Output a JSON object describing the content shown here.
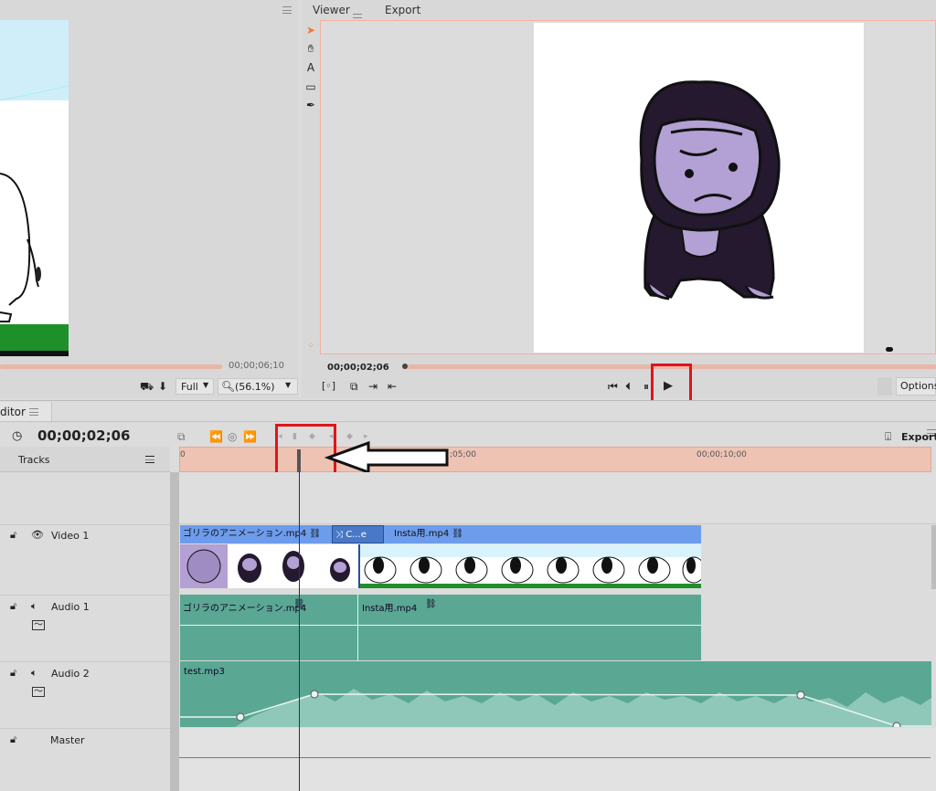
{
  "source": {
    "timecode": "00;00;06;10",
    "quality": "Full",
    "zoom": "(56.1%)"
  },
  "viewer": {
    "tabs": [
      "Viewer",
      "Export"
    ],
    "timecode": "00;00;02;06",
    "options_label": "Options"
  },
  "editor": {
    "title": "ditor",
    "timecode": "00;00;02;06",
    "export_label": "Export",
    "tracks_label": "Tracks",
    "ruler_ticks": [
      "0",
      ";05;00",
      "00;00;10;00"
    ],
    "tracks": [
      {
        "name": "Video 1"
      },
      {
        "name": "Audio 1"
      },
      {
        "name": "Audio 2"
      },
      {
        "name": "Master"
      }
    ],
    "video_clips": [
      {
        "label": "ゴリラのアニメーション.mp4"
      },
      {
        "label": "C...e"
      },
      {
        "label": "Insta用.mp4"
      }
    ],
    "audio1_clips": [
      {
        "label": "ゴリラのアニメーション.mp4"
      },
      {
        "label": "Insta用.mp4"
      }
    ],
    "audio2_clip": {
      "label": "test.mp3"
    }
  },
  "colors": {
    "accent": "#f07a2a",
    "highlight": "#e0141c",
    "video_clip": "#6d9cec",
    "audio_clip": "#5aa894",
    "ruler": "#eec3b4"
  }
}
